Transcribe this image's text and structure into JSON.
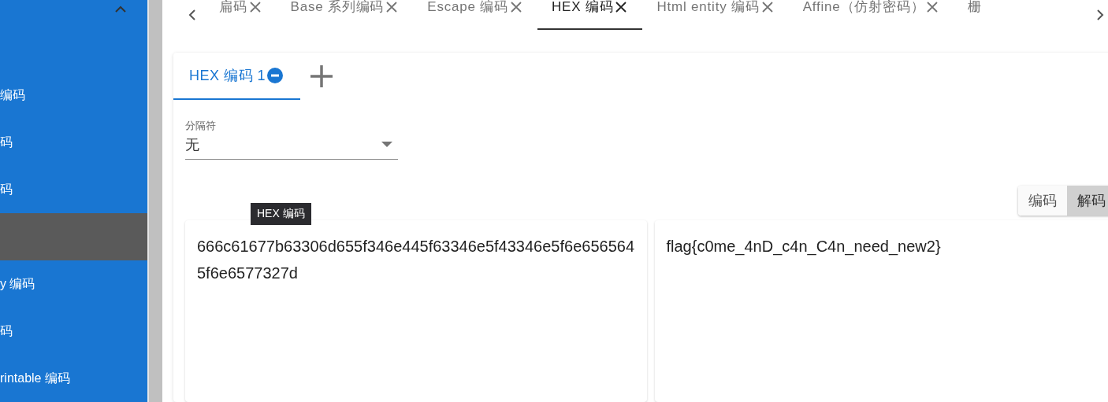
{
  "sidebar": {
    "header": {
      "expanded": true
    },
    "items": [
      {
        "label": "编码",
        "selected": false
      },
      {
        "label": "码",
        "selected": false
      },
      {
        "label": "码",
        "selected": false
      },
      {
        "selected": true
      },
      {
        "label": "y 编码",
        "selected": false
      },
      {
        "label": "码",
        "selected": false
      },
      {
        "label": "rintable 编码",
        "selected": false
      }
    ]
  },
  "tabs": [
    {
      "label": "扁码",
      "selected": false,
      "closable": true
    },
    {
      "label": "Base 系列编码",
      "selected": false,
      "closable": true
    },
    {
      "label": "Escape 编码",
      "selected": false,
      "closable": true
    },
    {
      "label": "HEX 编码",
      "selected": true,
      "closable": true
    },
    {
      "label": "Html entity 编码",
      "selected": false,
      "closable": true
    },
    {
      "label": "Affine（仿射密码）",
      "selected": false,
      "closable": true
    },
    {
      "label": "栅",
      "selected": false,
      "closable": false
    }
  ],
  "card": {
    "subtabs": [
      {
        "label": "HEX 编码 1",
        "selected": true
      }
    ],
    "separator": {
      "label": "分隔符",
      "value": "无"
    },
    "modes": [
      {
        "label": "编码",
        "selected": false
      },
      {
        "label": "解码",
        "selected": true
      }
    ],
    "tooltip": "HEX 编码",
    "input": "666c61677b63306d655f346e445f63346e5f43346e5f6e6565645f6e6577327d",
    "output": "flag{c0me_4nD_c4n_C4n_need_new2}"
  }
}
